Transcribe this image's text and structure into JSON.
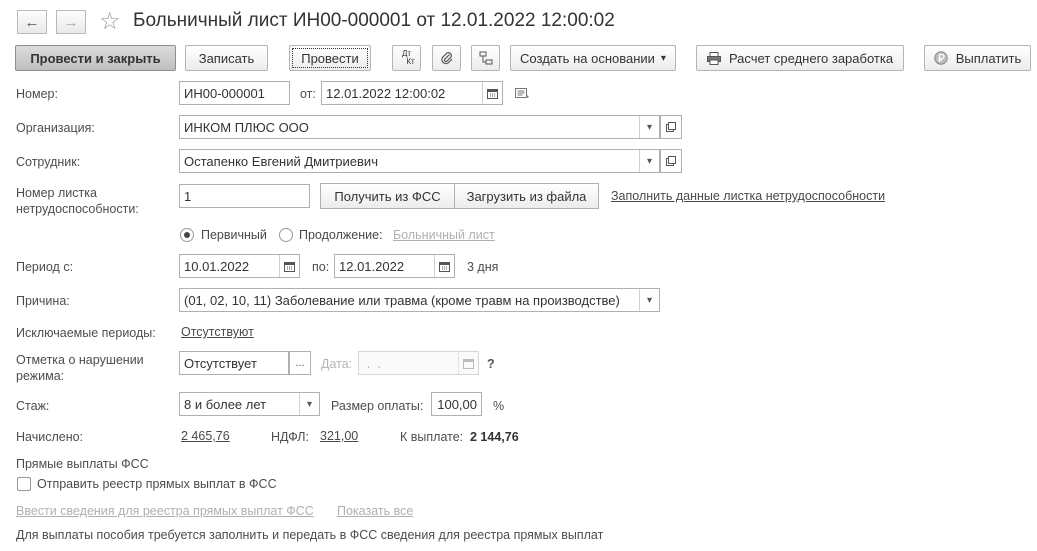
{
  "title": "Больничный лист ИН00-000001 от 12.01.2022 12:00:02",
  "nav": {
    "back": "←",
    "forward": "→",
    "star": "☆"
  },
  "toolbar": {
    "post_close": "Провести и закрыть",
    "save": "Записать",
    "post": "Провести",
    "dt_kt_top": "Дт",
    "dt_kt_bottom": "Кт",
    "create_based": "Создать на основании",
    "avg_earnings": "Расчет среднего заработка",
    "pay": "Выплатить"
  },
  "form": {
    "number_label": "Номер:",
    "number_value": "ИН00-000001",
    "date_from_label": "от:",
    "date_value": "12.01.2022 12:00:02",
    "org_label": "Организация:",
    "org_value": "ИНКОМ ПЛЮС ООО",
    "employee_label": "Сотрудник:",
    "employee_value": "Остапенко Евгений Дмитриевич",
    "sheet_number_label_1": "Номер листка",
    "sheet_number_label_2": "нетрудоспособности:",
    "sheet_number_value": "1",
    "get_fss": "Получить из ФСС",
    "load_file": "Загрузить из файла",
    "fill_sheet_link": "Заполнить данные листка нетрудоспособности",
    "radio_primary": "Первичный",
    "radio_continuation": "Продолжение:",
    "continuation_link": "Больничный лист",
    "period_label": "Период с:",
    "period_from": "10.01.2022",
    "period_to_label": "по:",
    "period_to": "12.01.2022",
    "period_days": "3 дня",
    "reason_label": "Причина:",
    "reason_value": "(01, 02, 10, 11) Заболевание или травма (кроме травм на производстве)",
    "excluded_label": "Исключаемые периоды:",
    "excluded_value": "Отсутствуют",
    "violation_label_1": "Отметка о нарушении",
    "violation_label_2": "режима:",
    "violation_value": "Отсутствует",
    "violation_date_label": "Дата:",
    "violation_date_value": " .  .",
    "question": "?",
    "seniority_label": "Стаж:",
    "seniority_value": "8 и более лет",
    "pay_rate_label": "Размер оплаты:",
    "pay_rate_value": "100,00",
    "percent": "%",
    "accrued_label": "Начислено:",
    "accrued_value": "2 465,76",
    "ndfl_label": "НДФЛ:",
    "ndfl_value": "321,00",
    "to_pay_label": "К выплате:",
    "to_pay_value": "2 144,76",
    "fss_section": "Прямые выплаты ФСС",
    "send_registry": "Отправить реестр прямых выплат в ФСС",
    "enter_info_link": "Ввести сведения для реестра прямых выплат ФСС",
    "show_all_link": "Показать все",
    "footer_note": "Для выплаты пособия требуется заполнить и передать в ФСС сведения для реестра прямых выплат"
  },
  "icons": {
    "dropdown": "▾",
    "ellipsis": "...",
    "open": "open-icon",
    "calendar": "calendar-icon",
    "paperclip": "paperclip-icon",
    "structure": "structure-icon",
    "printer": "printer-icon",
    "ruble": "ruble-icon"
  }
}
